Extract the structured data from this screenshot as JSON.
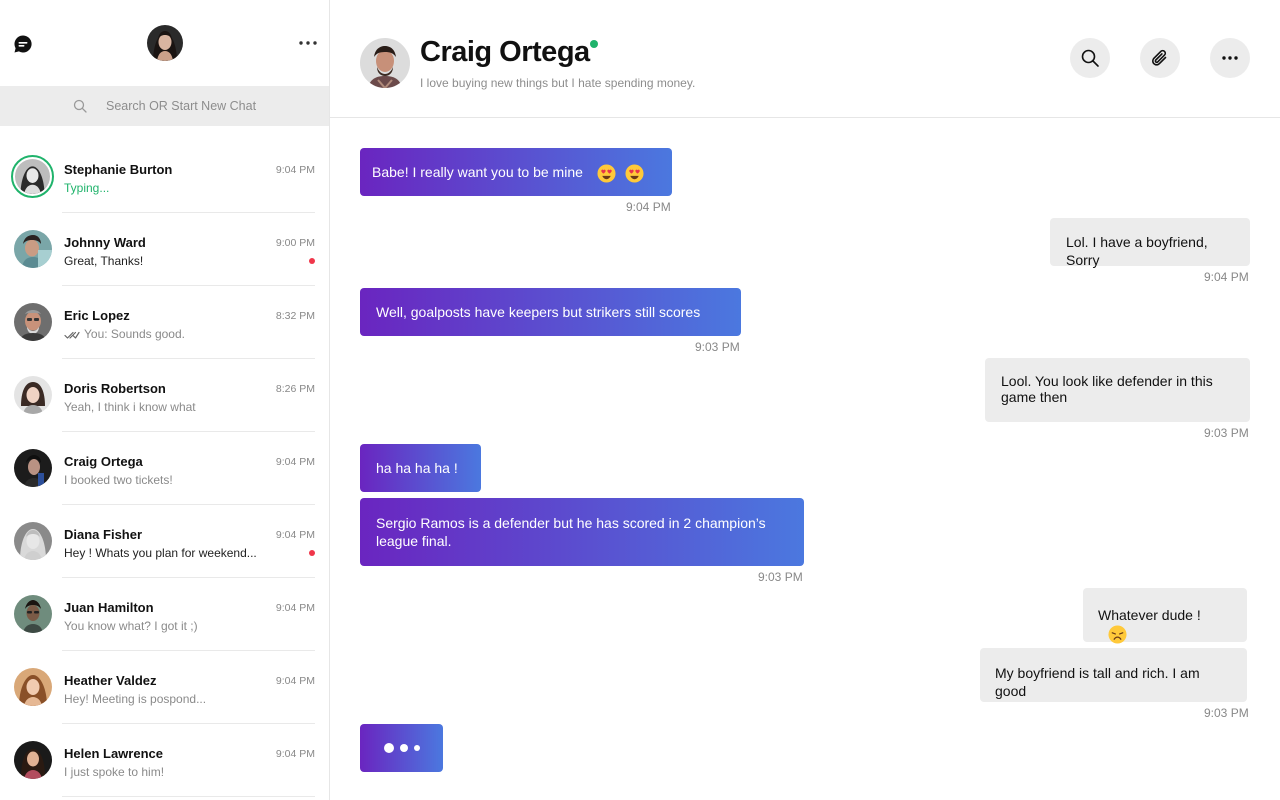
{
  "sidebar": {
    "search_placeholder": "Search OR Start New Chat",
    "chats": [
      {
        "name": "Stephanie Burton",
        "preview": "Typing...",
        "time": "9:04 PM",
        "state": "typing"
      },
      {
        "name": "Johnny Ward",
        "preview": "Great, Thanks!",
        "time": "9:00 PM",
        "state": "unread"
      },
      {
        "name": "Eric Lopez",
        "preview": "You: Sounds good.",
        "time": "8:32 PM",
        "state": "read"
      },
      {
        "name": "Doris Robertson",
        "preview": "Yeah, I think i know what",
        "time": "8:26 PM",
        "state": "normal"
      },
      {
        "name": "Craig Ortega",
        "preview": "I booked two tickets!",
        "time": "9:04 PM",
        "state": "normal"
      },
      {
        "name": "Diana Fisher",
        "preview": "Hey ! Whats you plan for weekend...",
        "time": "9:04 PM",
        "state": "unread"
      },
      {
        "name": "Juan Hamilton",
        "preview": "You know what? I got it ;)",
        "time": "9:04 PM",
        "state": "normal"
      },
      {
        "name": "Heather Valdez",
        "preview": "Hey! Meeting is pospond...",
        "time": "9:04 PM",
        "state": "normal"
      },
      {
        "name": "Helen Lawrence",
        "preview": "I just spoke to him!",
        "time": "9:04 PM",
        "state": "normal"
      }
    ]
  },
  "header": {
    "name": "Craig Ortega",
    "status": "I love buying new things but I hate spending money.",
    "online": true
  },
  "messages": [
    {
      "direction": "in",
      "text": "Babe! I really want you to be mine",
      "emoji": [
        "heart-eyes-emoji",
        "heart-eyes-emoji"
      ],
      "time": "9:04 PM"
    },
    {
      "direction": "out",
      "text": "Lol. I have a boyfriend, Sorry",
      "time": "9:04 PM"
    },
    {
      "direction": "in",
      "text": "Well, goalposts have keepers but strikers still scores",
      "time": "9:03 PM"
    },
    {
      "direction": "out",
      "text": "Lool. You look like defender in this game then",
      "time": "9:03 PM"
    },
    {
      "direction": "in",
      "text": "ha ha ha ha !"
    },
    {
      "direction": "in",
      "text": "Sergio Ramos is a defender but he has scored in 2 champion’s league final.",
      "time": "9:03 PM"
    },
    {
      "direction": "out",
      "text": "Whatever dude !",
      "emoji": [
        "disappointed-emoji"
      ]
    },
    {
      "direction": "out",
      "text": "My boyfriend is tall and rich. I am good",
      "time": "9:03 PM"
    }
  ],
  "colors": {
    "accent_start": "#6a25c0",
    "accent_end": "#4b78df",
    "online": "#1fb36b",
    "unread": "#f0364a"
  },
  "icons": {
    "logo": "chat-bubble-icon",
    "sidebar_more": "more-horizontal-icon",
    "search": "search-icon",
    "attach": "paperclip-icon",
    "header_more": "more-horizontal-icon",
    "read_receipt": "double-check-icon"
  }
}
